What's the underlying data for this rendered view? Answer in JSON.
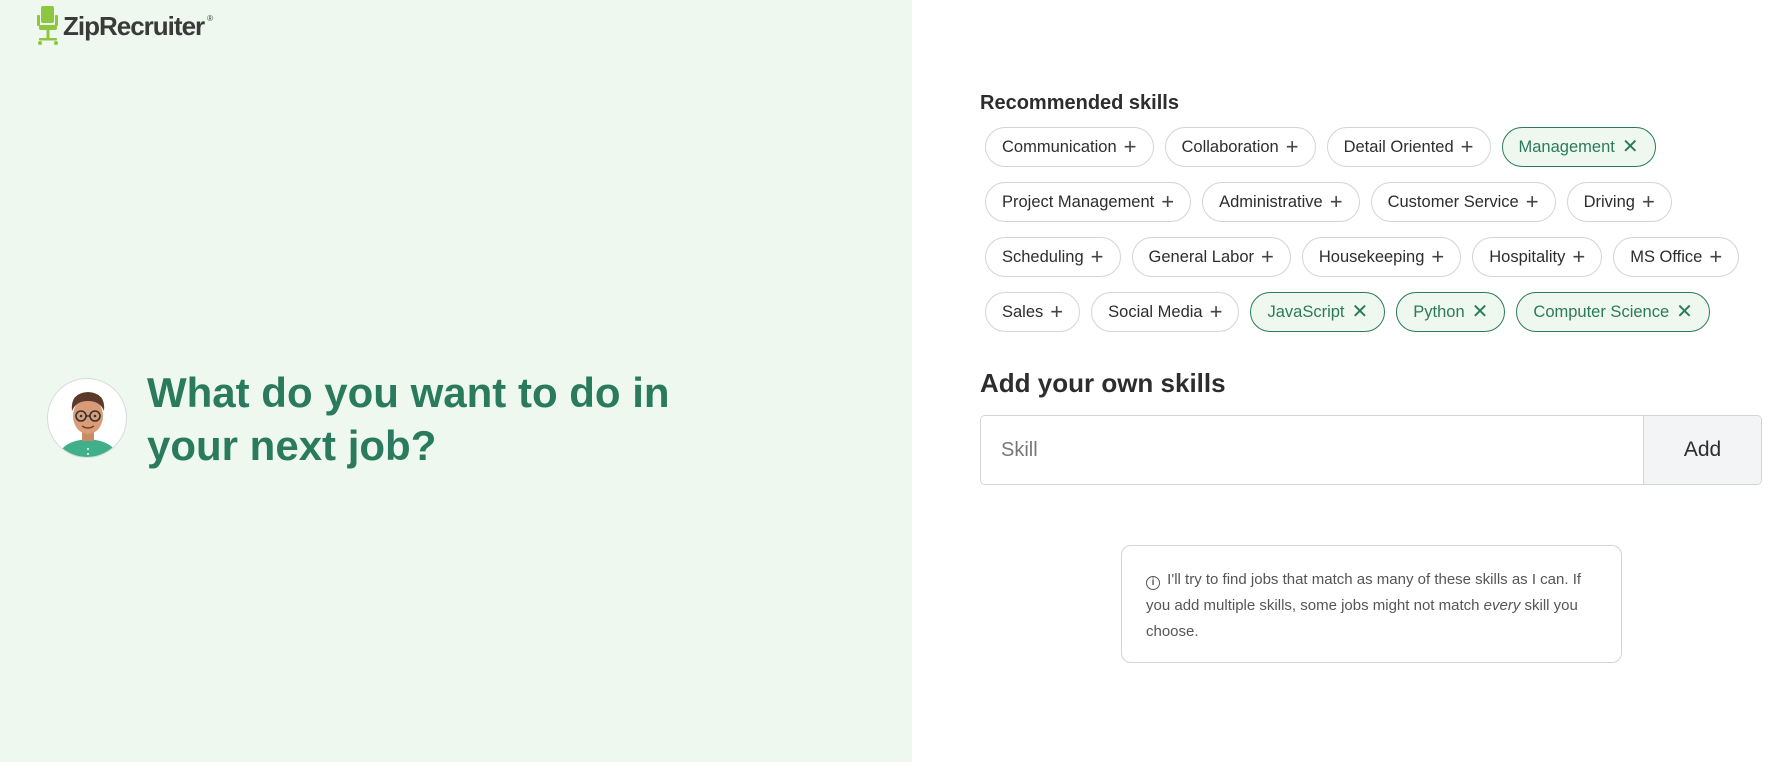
{
  "brand": {
    "name": "ZipRecruiter",
    "reg_mark": "®",
    "color": "#8dc63f"
  },
  "left": {
    "headline": "What do you want to do in your next job?",
    "avatar_icon": "assistant-avatar",
    "background": "#eef8ef",
    "accent": "#2a7a5d"
  },
  "recommended": {
    "title": "Recommended skills",
    "skills": [
      {
        "label": "Communication",
        "selected": false
      },
      {
        "label": "Collaboration",
        "selected": false
      },
      {
        "label": "Detail Oriented",
        "selected": false
      },
      {
        "label": "Management",
        "selected": true
      },
      {
        "label": "Project Management",
        "selected": false
      },
      {
        "label": "Administrative",
        "selected": false
      },
      {
        "label": "Customer Service",
        "selected": false
      },
      {
        "label": "Driving",
        "selected": false
      },
      {
        "label": "Scheduling",
        "selected": false
      },
      {
        "label": "General Labor",
        "selected": false
      },
      {
        "label": "Housekeeping",
        "selected": false
      },
      {
        "label": "Hospitality",
        "selected": false
      },
      {
        "label": "MS Office",
        "selected": false
      },
      {
        "label": "Sales",
        "selected": false
      },
      {
        "label": "Social Media",
        "selected": false
      },
      {
        "label": "JavaScript",
        "selected": true
      },
      {
        "label": "Python",
        "selected": true
      },
      {
        "label": "Computer Science",
        "selected": true
      }
    ],
    "add_icon": "plus-icon",
    "remove_icon": "close-icon"
  },
  "own_skills": {
    "title": "Add your own skills",
    "placeholder": "Skill",
    "value": "",
    "add_label": "Add"
  },
  "info": {
    "icon": "info-icon",
    "text_before": "I'll try to find jobs that match as many of these skills as I can. If you add multiple skills, some jobs might not match ",
    "text_emphasis": "every",
    "text_after": " skill you choose."
  }
}
